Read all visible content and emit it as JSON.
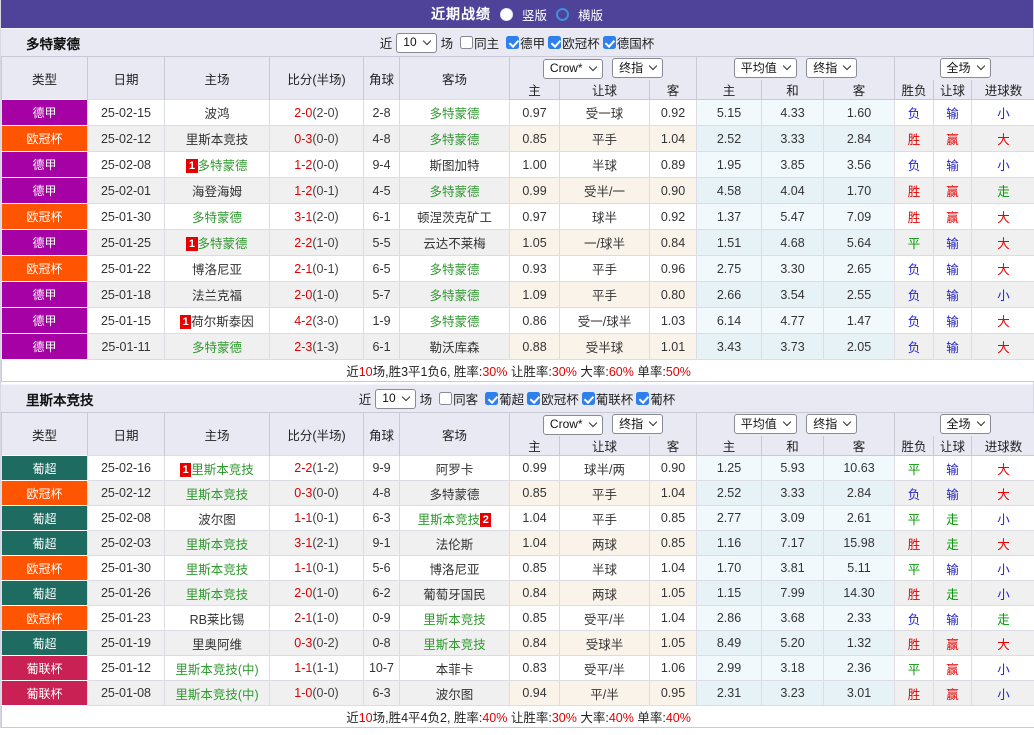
{
  "title_bar": {
    "title": "近期战绩",
    "options": [
      {
        "label": "竖版",
        "selected": true
      },
      {
        "label": "横版",
        "selected": false
      }
    ]
  },
  "table_headers": {
    "type": "类型",
    "date": "日期",
    "home": "主场",
    "score": "比分(半场)",
    "corner": "角球",
    "away": "客场",
    "odds_selects": [
      "Crow*",
      "终指"
    ],
    "avg_selects": [
      "平均值",
      "终指"
    ],
    "scope_select": "全场",
    "sub": [
      "主",
      "让球",
      "客",
      "主",
      "和",
      "客",
      "胜负",
      "让球",
      "进球数"
    ]
  },
  "league_colors": {
    "德甲": "#a501a5",
    "欧冠杯": "#ff5502",
    "葡超": "#1e6b62",
    "葡联杯": "#c92153"
  },
  "result_colors": {
    "r": "#e60000",
    "b": "#2323cc",
    "g": "#009900"
  },
  "sections": [
    {
      "team": "多特蒙德",
      "controls": {
        "prefix": "近",
        "count": "10",
        "suffix": "场",
        "same": {
          "label": "同主",
          "checked": false
        },
        "leagues": [
          {
            "label": "德甲",
            "checked": true
          },
          {
            "label": "欧冠杯",
            "checked": true
          },
          {
            "label": "德国杯",
            "checked": true
          }
        ]
      },
      "rows": [
        {
          "league": "德甲",
          "date": "25-02-15",
          "home": {
            "name": "波鸿",
            "green": false
          },
          "score": "2-0",
          "half": "(2-0)",
          "corner": "2-8",
          "away": {
            "name": "多特蒙德",
            "green": true
          },
          "crow": [
            "0.97",
            "受一球",
            "0.92"
          ],
          "avg": [
            "5.15",
            "4.33",
            "1.60"
          ],
          "res": [
            [
              "负",
              "b"
            ],
            [
              "输",
              "b"
            ],
            [
              "小",
              "b"
            ]
          ]
        },
        {
          "league": "欧冠杯",
          "date": "25-02-12",
          "home": {
            "name": "里斯本竞技",
            "green": false
          },
          "score": "0-3",
          "half": "(0-0)",
          "corner": "4-8",
          "away": {
            "name": "多特蒙德",
            "green": true
          },
          "crow": [
            "0.85",
            "平手",
            "1.04"
          ],
          "avg": [
            "2.52",
            "3.33",
            "2.84"
          ],
          "res": [
            [
              "胜",
              "r"
            ],
            [
              "赢",
              "r"
            ],
            [
              "大",
              "r"
            ]
          ]
        },
        {
          "league": "德甲",
          "date": "25-02-08",
          "home": {
            "name": "多特蒙德",
            "green": true,
            "badge": "1",
            "badge_pos": "before"
          },
          "score": "1-2",
          "half": "(0-0)",
          "corner": "9-4",
          "away": {
            "name": "斯图加特",
            "green": false
          },
          "crow": [
            "1.00",
            "半球",
            "0.89"
          ],
          "avg": [
            "1.95",
            "3.85",
            "3.56"
          ],
          "res": [
            [
              "负",
              "b"
            ],
            [
              "输",
              "b"
            ],
            [
              "小",
              "b"
            ]
          ]
        },
        {
          "league": "德甲",
          "date": "25-02-01",
          "home": {
            "name": "海登海姆",
            "green": false
          },
          "score": "1-2",
          "half": "(0-1)",
          "corner": "4-5",
          "away": {
            "name": "多特蒙德",
            "green": true
          },
          "crow": [
            "0.99",
            "受半/一",
            "0.90"
          ],
          "avg": [
            "4.58",
            "4.04",
            "1.70"
          ],
          "res": [
            [
              "胜",
              "r"
            ],
            [
              "赢",
              "r"
            ],
            [
              "走",
              "g"
            ]
          ]
        },
        {
          "league": "欧冠杯",
          "date": "25-01-30",
          "home": {
            "name": "多特蒙德",
            "green": true
          },
          "score": "3-1",
          "half": "(2-0)",
          "corner": "6-1",
          "away": {
            "name": "顿涅茨克矿工",
            "green": false
          },
          "crow": [
            "0.97",
            "球半",
            "0.92"
          ],
          "avg": [
            "1.37",
            "5.47",
            "7.09"
          ],
          "res": [
            [
              "胜",
              "r"
            ],
            [
              "赢",
              "r"
            ],
            [
              "大",
              "r"
            ]
          ]
        },
        {
          "league": "德甲",
          "date": "25-01-25",
          "home": {
            "name": "多特蒙德",
            "green": true,
            "badge": "1",
            "badge_pos": "before"
          },
          "score": "2-2",
          "half": "(1-0)",
          "corner": "5-5",
          "away": {
            "name": "云达不莱梅",
            "green": false
          },
          "crow": [
            "1.05",
            "一/球半",
            "0.84"
          ],
          "avg": [
            "1.51",
            "4.68",
            "5.64"
          ],
          "res": [
            [
              "平",
              "g"
            ],
            [
              "输",
              "b"
            ],
            [
              "大",
              "r"
            ]
          ]
        },
        {
          "league": "欧冠杯",
          "date": "25-01-22",
          "home": {
            "name": "博洛尼亚",
            "green": false
          },
          "score": "2-1",
          "half": "(0-1)",
          "corner": "6-5",
          "away": {
            "name": "多特蒙德",
            "green": true
          },
          "crow": [
            "0.93",
            "平手",
            "0.96"
          ],
          "avg": [
            "2.75",
            "3.30",
            "2.65"
          ],
          "res": [
            [
              "负",
              "b"
            ],
            [
              "输",
              "b"
            ],
            [
              "大",
              "r"
            ]
          ]
        },
        {
          "league": "德甲",
          "date": "25-01-18",
          "home": {
            "name": "法兰克福",
            "green": false
          },
          "score": "2-0",
          "half": "(1-0)",
          "corner": "5-7",
          "away": {
            "name": "多特蒙德",
            "green": true
          },
          "crow": [
            "1.09",
            "平手",
            "0.80"
          ],
          "avg": [
            "2.66",
            "3.54",
            "2.55"
          ],
          "res": [
            [
              "负",
              "b"
            ],
            [
              "输",
              "b"
            ],
            [
              "小",
              "b"
            ]
          ]
        },
        {
          "league": "德甲",
          "date": "25-01-15",
          "home": {
            "name": "荷尔斯泰因",
            "green": false,
            "badge": "1",
            "badge_pos": "before"
          },
          "score": "4-2",
          "half": "(3-0)",
          "corner": "1-9",
          "away": {
            "name": "多特蒙德",
            "green": true
          },
          "crow": [
            "0.86",
            "受一/球半",
            "1.03"
          ],
          "avg": [
            "6.14",
            "4.77",
            "1.47"
          ],
          "res": [
            [
              "负",
              "b"
            ],
            [
              "输",
              "b"
            ],
            [
              "大",
              "r"
            ]
          ]
        },
        {
          "league": "德甲",
          "date": "25-01-11",
          "home": {
            "name": "多特蒙德",
            "green": true
          },
          "score": "2-3",
          "half": "(1-3)",
          "corner": "6-1",
          "away": {
            "name": "勒沃库森",
            "green": false
          },
          "crow": [
            "0.88",
            "受半球",
            "1.01"
          ],
          "avg": [
            "3.43",
            "3.73",
            "2.05"
          ],
          "res": [
            [
              "负",
              "b"
            ],
            [
              "输",
              "b"
            ],
            [
              "大",
              "r"
            ]
          ]
        }
      ],
      "summary": [
        {
          "t": "近",
          "red": false
        },
        {
          "t": "10",
          "red": true
        },
        {
          "t": "场,胜3平1负6, 胜率:",
          "red": false
        },
        {
          "t": "30%",
          "red": true
        },
        {
          "t": " 让胜率:",
          "red": false
        },
        {
          "t": "30%",
          "red": true
        },
        {
          "t": " 大率:",
          "red": false
        },
        {
          "t": "60%",
          "red": true
        },
        {
          "t": " 单率:",
          "red": false
        },
        {
          "t": "50%",
          "red": true
        }
      ]
    },
    {
      "team": "里斯本竞技",
      "controls": {
        "prefix": "近",
        "count": "10",
        "suffix": "场",
        "same": {
          "label": "同客",
          "checked": false
        },
        "leagues": [
          {
            "label": "葡超",
            "checked": true
          },
          {
            "label": "欧冠杯",
            "checked": true
          },
          {
            "label": "葡联杯",
            "checked": true
          },
          {
            "label": "葡杯",
            "checked": true
          }
        ]
      },
      "rows": [
        {
          "league": "葡超",
          "date": "25-02-16",
          "home": {
            "name": "里斯本竞技",
            "green": true,
            "badge": "1",
            "badge_pos": "before"
          },
          "score": "2-2",
          "half": "(1-2)",
          "corner": "9-9",
          "away": {
            "name": "阿罗卡",
            "green": false
          },
          "crow": [
            "0.99",
            "球半/两",
            "0.90"
          ],
          "avg": [
            "1.25",
            "5.93",
            "10.63"
          ],
          "res": [
            [
              "平",
              "g"
            ],
            [
              "输",
              "b"
            ],
            [
              "大",
              "r"
            ]
          ]
        },
        {
          "league": "欧冠杯",
          "date": "25-02-12",
          "home": {
            "name": "里斯本竞技",
            "green": true
          },
          "score": "0-3",
          "half": "(0-0)",
          "corner": "4-8",
          "away": {
            "name": "多特蒙德",
            "green": false
          },
          "crow": [
            "0.85",
            "平手",
            "1.04"
          ],
          "avg": [
            "2.52",
            "3.33",
            "2.84"
          ],
          "res": [
            [
              "负",
              "b"
            ],
            [
              "输",
              "b"
            ],
            [
              "大",
              "r"
            ]
          ]
        },
        {
          "league": "葡超",
          "date": "25-02-08",
          "home": {
            "name": "波尔图",
            "green": false
          },
          "score": "1-1",
          "half": "(0-1)",
          "corner": "6-3",
          "away": {
            "name": "里斯本竞技",
            "green": true,
            "badge": "2",
            "badge_pos": "after"
          },
          "crow": [
            "1.04",
            "平手",
            "0.85"
          ],
          "avg": [
            "2.77",
            "3.09",
            "2.61"
          ],
          "res": [
            [
              "平",
              "g"
            ],
            [
              "走",
              "g"
            ],
            [
              "小",
              "b"
            ]
          ]
        },
        {
          "league": "葡超",
          "date": "25-02-03",
          "home": {
            "name": "里斯本竞技",
            "green": true
          },
          "score": "3-1",
          "half": "(2-1)",
          "corner": "9-1",
          "away": {
            "name": "法伦斯",
            "green": false
          },
          "crow": [
            "1.04",
            "两球",
            "0.85"
          ],
          "avg": [
            "1.16",
            "7.17",
            "15.98"
          ],
          "res": [
            [
              "胜",
              "r"
            ],
            [
              "走",
              "g"
            ],
            [
              "大",
              "r"
            ]
          ]
        },
        {
          "league": "欧冠杯",
          "date": "25-01-30",
          "home": {
            "name": "里斯本竞技",
            "green": true
          },
          "score": "1-1",
          "half": "(0-1)",
          "corner": "5-6",
          "away": {
            "name": "博洛尼亚",
            "green": false
          },
          "crow": [
            "0.85",
            "半球",
            "1.04"
          ],
          "avg": [
            "1.70",
            "3.81",
            "5.11"
          ],
          "res": [
            [
              "平",
              "g"
            ],
            [
              "输",
              "b"
            ],
            [
              "小",
              "b"
            ]
          ]
        },
        {
          "league": "葡超",
          "date": "25-01-26",
          "home": {
            "name": "里斯本竞技",
            "green": true
          },
          "score": "2-0",
          "half": "(1-0)",
          "corner": "6-2",
          "away": {
            "name": "葡萄牙国民",
            "green": false
          },
          "crow": [
            "0.84",
            "两球",
            "1.05"
          ],
          "avg": [
            "1.15",
            "7.99",
            "14.30"
          ],
          "res": [
            [
              "胜",
              "r"
            ],
            [
              "走",
              "g"
            ],
            [
              "小",
              "b"
            ]
          ]
        },
        {
          "league": "欧冠杯",
          "date": "25-01-23",
          "home": {
            "name": "RB莱比锡",
            "green": false
          },
          "score": "2-1",
          "half": "(1-0)",
          "corner": "0-9",
          "away": {
            "name": "里斯本竞技",
            "green": true
          },
          "crow": [
            "0.85",
            "受平/半",
            "1.04"
          ],
          "avg": [
            "2.86",
            "3.68",
            "2.33"
          ],
          "res": [
            [
              "负",
              "b"
            ],
            [
              "输",
              "b"
            ],
            [
              "走",
              "g"
            ]
          ]
        },
        {
          "league": "葡超",
          "date": "25-01-19",
          "home": {
            "name": "里奥阿维",
            "green": false
          },
          "score": "0-3",
          "half": "(0-2)",
          "corner": "0-8",
          "away": {
            "name": "里斯本竞技",
            "green": true
          },
          "crow": [
            "0.84",
            "受球半",
            "1.05"
          ],
          "avg": [
            "8.49",
            "5.20",
            "1.32"
          ],
          "res": [
            [
              "胜",
              "r"
            ],
            [
              "赢",
              "r"
            ],
            [
              "大",
              "r"
            ]
          ]
        },
        {
          "league": "葡联杯",
          "date": "25-01-12",
          "home": {
            "name": "里斯本竞技(中)",
            "green": true
          },
          "score": "1-1",
          "half": "(1-1)",
          "corner": "10-7",
          "away": {
            "name": "本菲卡",
            "green": false
          },
          "crow": [
            "0.83",
            "受平/半",
            "1.06"
          ],
          "avg": [
            "2.99",
            "3.18",
            "2.36"
          ],
          "res": [
            [
              "平",
              "g"
            ],
            [
              "赢",
              "r"
            ],
            [
              "小",
              "b"
            ]
          ]
        },
        {
          "league": "葡联杯",
          "date": "25-01-08",
          "home": {
            "name": "里斯本竞技(中)",
            "green": true
          },
          "score": "1-0",
          "half": "(0-0)",
          "corner": "6-3",
          "away": {
            "name": "波尔图",
            "green": false
          },
          "crow": [
            "0.94",
            "平/半",
            "0.95"
          ],
          "avg": [
            "2.31",
            "3.23",
            "3.01"
          ],
          "res": [
            [
              "胜",
              "r"
            ],
            [
              "赢",
              "r"
            ],
            [
              "小",
              "b"
            ]
          ]
        }
      ],
      "summary": [
        {
          "t": "近",
          "red": false
        },
        {
          "t": "10",
          "red": true
        },
        {
          "t": "场,胜4平4负2, 胜率:",
          "red": false
        },
        {
          "t": "40%",
          "red": true
        },
        {
          "t": " 让胜率:",
          "red": false
        },
        {
          "t": "30%",
          "red": true
        },
        {
          "t": " 大率:",
          "red": false
        },
        {
          "t": "40%",
          "red": true
        },
        {
          "t": " 单率:",
          "red": false
        },
        {
          "t": "40%",
          "red": true
        }
      ]
    }
  ]
}
